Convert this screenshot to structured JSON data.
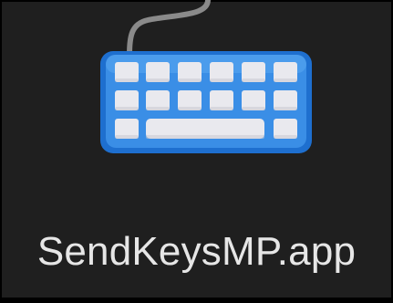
{
  "file": {
    "name": "SendKeysMP.app",
    "icon": "keyboard-icon"
  },
  "colors": {
    "background": "#1f1f1f",
    "label_text": "#e6e6e6",
    "keyboard_body": "#3a8ee6",
    "keyboard_rim": "#1e6fcf",
    "keys": "#e9e9ee",
    "cable": "#8a8a8a"
  }
}
